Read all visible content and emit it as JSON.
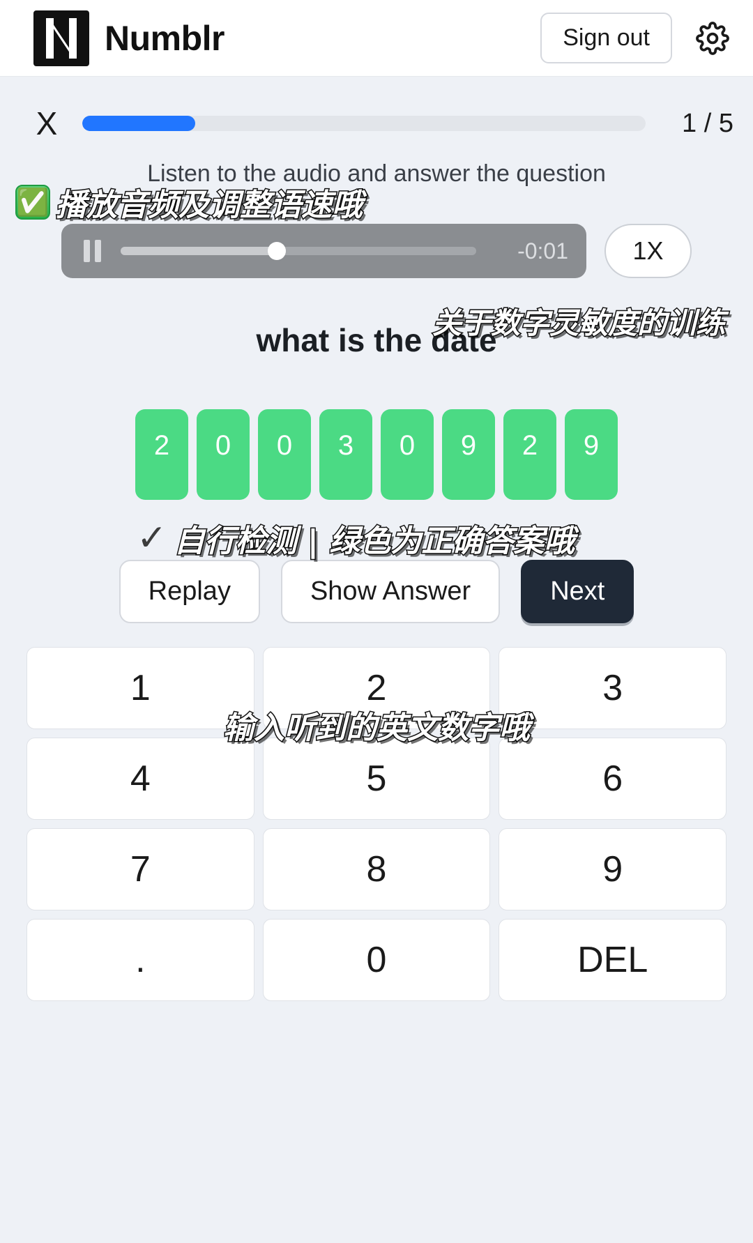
{
  "header": {
    "logo_glyph": "N",
    "brand": "Numblr",
    "signout_label": "Sign out",
    "gear_icon": "gear-icon"
  },
  "progress": {
    "close_label": "X",
    "percent": 20,
    "counter": "1 / 5",
    "fill_color": "#2176ff",
    "track_color": "#e2e5ea"
  },
  "exercise": {
    "instruction": "Listen to the audio and answer the question",
    "question": "what is the date"
  },
  "audio": {
    "state_icon": "pause-icon",
    "time_remaining": "-0:01",
    "scrub_percent": 44,
    "speed_label": "1X"
  },
  "answer": {
    "digits": [
      "2",
      "0",
      "0",
      "3",
      "0",
      "9",
      "2",
      "9"
    ],
    "tile_color": "#4bda84",
    "digit_color": "#ffffff"
  },
  "actions": {
    "replay_label": "Replay",
    "show_answer_label": "Show Answer",
    "next_label": "Next",
    "next_bg": "#1f2937"
  },
  "keypad": {
    "keys": [
      "1",
      "2",
      "3",
      "4",
      "5",
      "6",
      "7",
      "8",
      "9",
      ".",
      "0",
      "DEL"
    ]
  },
  "annotations": {
    "audio_note": "播放音频及调整语速哦",
    "audio_note_icon": "✅",
    "topic_note": "关于数字灵敏度的训练",
    "answer_note": "自行检测 | 绿色为正确答案哦",
    "answer_note_icon": "✓",
    "keypad_note": "输入听到的英文数字哦"
  }
}
